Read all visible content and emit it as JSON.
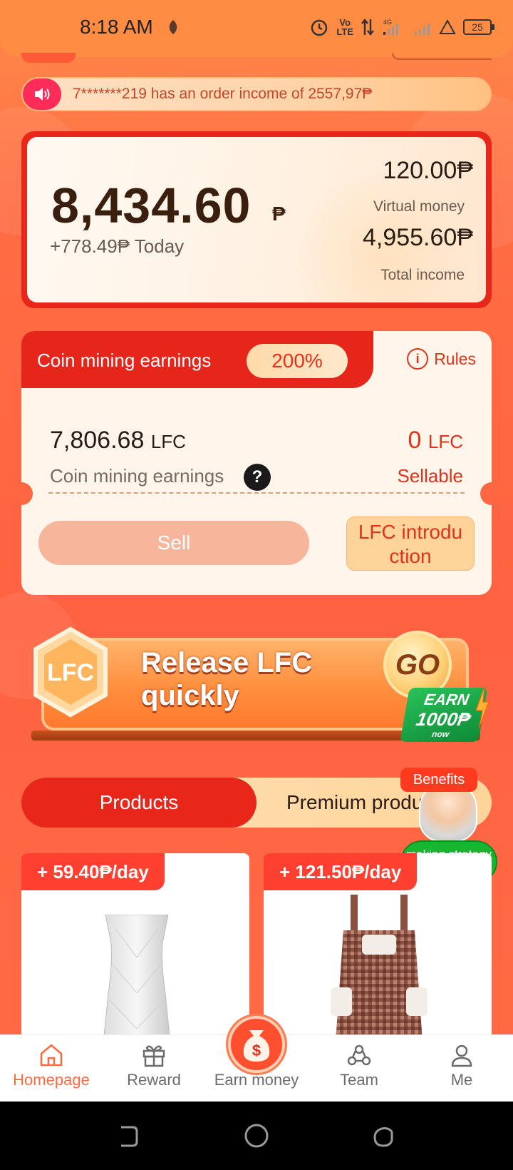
{
  "status_bar": {
    "time": "8:18 AM",
    "network": "Vo\nLTE",
    "signal_label": "4G",
    "battery": "25"
  },
  "notice": {
    "text": "7*******219 has an order income of 2557,97₱"
  },
  "balance": {
    "amount": "8,434.60",
    "currency": "₱",
    "today": "+778.49₱ Today",
    "virtual_money_amount": "120.00₱",
    "virtual_money_label": "Virtual money",
    "total_income_amount": "4,955.60₱",
    "total_income_label": "Total income"
  },
  "mining": {
    "title": "Coin mining earnings",
    "rate": "200%",
    "rules_label": "Rules",
    "earnings_value": "7,806.68",
    "earnings_unit": "LFC",
    "earnings_label": "Coin mining earnings",
    "help_icon": "?",
    "sellable_value": "0",
    "sellable_unit": "LFC",
    "sellable_label": "Sellable",
    "sell_button": "Sell",
    "intro_button": "LFC introdu ction"
  },
  "release_banner": {
    "badge": "LFC",
    "title_line1": "Release  LFC",
    "title_line2": "quickly",
    "go_label": "GO",
    "earn_line1": "EARN",
    "earn_line2": "1000₱",
    "earn_line3": "now"
  },
  "tabs": {
    "products": "Products",
    "premium": "Premium products"
  },
  "floating": {
    "benefits": "Benefits",
    "strategy": "making strategy"
  },
  "products": [
    {
      "tag": "+ 59.40₱/day"
    },
    {
      "tag": "+ 121.50₱/day"
    }
  ],
  "bottom_nav": [
    {
      "label": "Homepage"
    },
    {
      "label": "Reward"
    },
    {
      "label": "Earn money"
    },
    {
      "label": "Team"
    },
    {
      "label": "Me"
    }
  ],
  "colors": {
    "accent": "#e8261a",
    "background": "#ff6241",
    "active_nav": "#ff6a3d"
  }
}
